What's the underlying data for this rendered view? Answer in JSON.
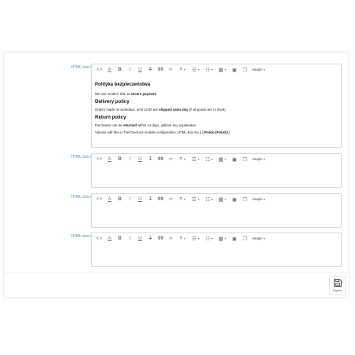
{
  "boxes": [
    {
      "label": "HTML box nr.1",
      "content": {
        "h1": "Polityka bezpieczeństwa",
        "p1_pre": "We use modern SSL to ",
        "p1_bold": "secure payment",
        "h2": "Delivery policy",
        "p2_pre": "Orders made on workdays, until 13:00 are ",
        "p2_bold": "shipped same day",
        "p2_post": " (if all goods are in stock)",
        "h3": "Return policy",
        "p3_pre": "Purchases can be ",
        "p3_bold": "returned",
        "p3_post": " within 14 days, without any explanation",
        "p4_pre": "*please edit this in TheCheckout module configuration, HTML Box No.1 ",
        "p4_bold": "[ Polski (Polish) ]"
      }
    },
    {
      "label": "HTML box nr.2"
    },
    {
      "label": "HTML box nr.3"
    },
    {
      "label": "HTML box nr.4"
    }
  ],
  "toolbar": {
    "code": "<>",
    "font_color": "A",
    "bold": "B",
    "italic": "I",
    "underline": "U",
    "strike": "T",
    "quote": "99",
    "link": "∞",
    "align": "≡",
    "bullets": "☰",
    "numbers": "☷",
    "table": "▦",
    "image": "▣",
    "media": "❐",
    "format": "Akapit",
    "drop": "▼"
  },
  "save": {
    "label": "Zapisz"
  },
  "colors": {
    "label": "#4a8fba",
    "border": "#d6d9dd",
    "icon": "#6c757d"
  }
}
